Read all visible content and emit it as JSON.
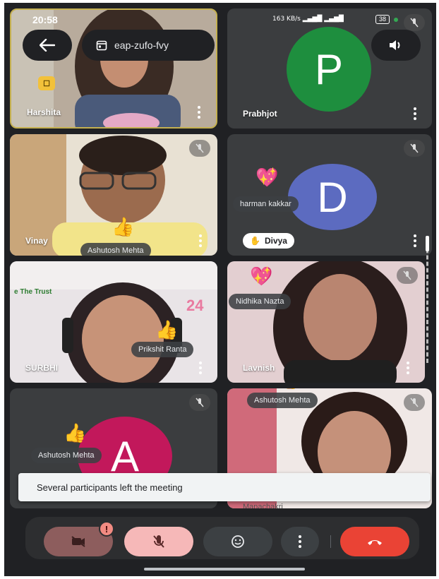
{
  "status_bar": {
    "time": "20:58",
    "net_speed": "163 KB/s",
    "battery": "38"
  },
  "top_bar": {
    "meeting_code": "eap-zufo-fvy",
    "back_icon": "arrow-left-icon",
    "calendar_icon": "calendar-icon",
    "speaker_icon": "speaker-icon"
  },
  "tiles": [
    {
      "name": "Harshita",
      "type": "video",
      "bg": "#a89a8a"
    },
    {
      "name": "Prabhjot",
      "type": "avatar",
      "initial": "P",
      "avatar_color": "#1e8e3e"
    },
    {
      "name": "Vinay",
      "type": "video",
      "bg": "#c9b89a",
      "float_label": "Ashutosh Mehta",
      "emoji": "👍"
    },
    {
      "name": "Divya",
      "type": "avatar",
      "initial": "D",
      "avatar_color": "#5c6bc0",
      "float_label": "harman kakkar",
      "emoji": "💖",
      "hand_raised": true
    },
    {
      "name": "SURBHI",
      "type": "video",
      "bg": "#d8d3d5",
      "float_label": "Prikshit Ranta",
      "emoji": "👍",
      "banner_text": "e The Trust"
    },
    {
      "name": "Lavnish",
      "type": "video",
      "bg": "#b99a94",
      "float_label": "Nidhika Nazta",
      "emoji": "💖"
    },
    {
      "name": "",
      "type": "avatar",
      "initial": "A",
      "avatar_color": "#c2185b",
      "float_label": "Ashutosh Mehta",
      "emoji": "👍"
    },
    {
      "name": "Manachakri",
      "type": "video",
      "bg": "#c9a7a3",
      "float_label": "Ashutosh Mehta",
      "emoji": "👍"
    }
  ],
  "snackbar": {
    "message": "Several participants left the meeting"
  },
  "controls": {
    "camera_icon": "camera-off-icon",
    "mic_icon": "mic-off-icon",
    "emoji_icon": "emoji-icon",
    "more_icon": "more-vertical-icon",
    "end_call_icon": "end-call-icon",
    "alert_badge": "!"
  },
  "colors": {
    "end_call": "#ea4335",
    "mic_active": "#f6b8b8",
    "camera_active": "#8d5d5d",
    "background": "#202124"
  }
}
